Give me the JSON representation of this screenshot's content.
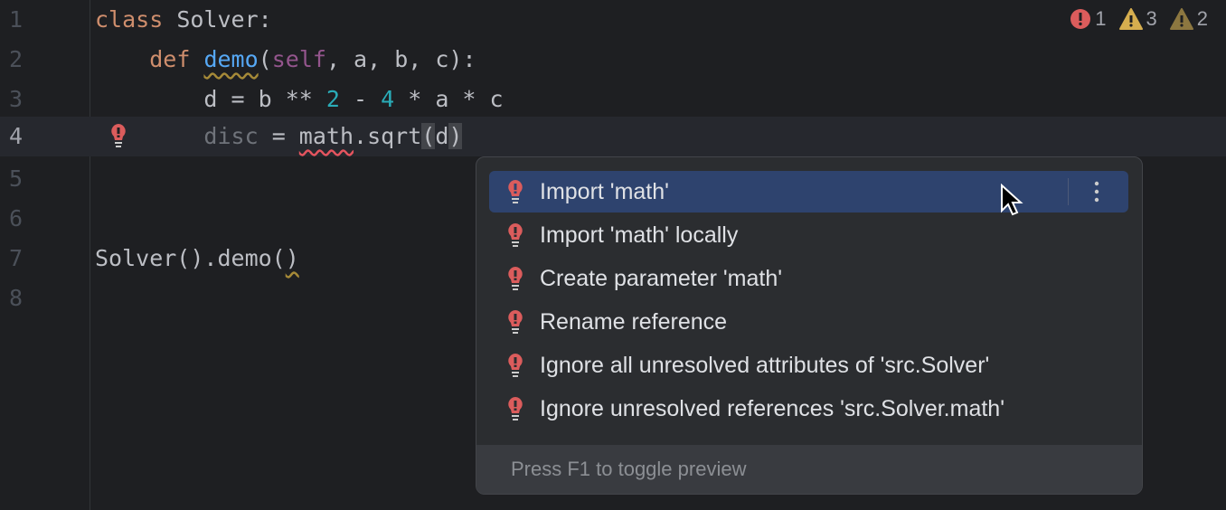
{
  "editor": {
    "line_numbers": [
      "1",
      "2",
      "3",
      "4",
      "5",
      "6",
      "7",
      "8"
    ],
    "lines": {
      "l1": [
        "class",
        " Solver:"
      ],
      "l2": [
        "def ",
        "demo",
        "(",
        "self",
        ", a, b, c):"
      ],
      "l3": [
        "d = b ** ",
        "2",
        " - ",
        "4",
        " * a * c"
      ],
      "l4": [
        "disc",
        " = ",
        "math",
        ".sqrt",
        "(",
        "d",
        ")"
      ],
      "l7": [
        "Solver().demo(",
        ")"
      ]
    }
  },
  "inspections": {
    "errors": "1",
    "warnings": "3",
    "weak_warnings": "2"
  },
  "popup": {
    "items": [
      "Import 'math'",
      "Import 'math' locally",
      "Create parameter 'math'",
      "Rename reference",
      "Ignore all unresolved attributes of 'src.Solver'",
      "Ignore unresolved references 'src.Solver.math'"
    ],
    "footer": "Press F1 to toggle preview"
  },
  "colors": {
    "error": "#db5c5c",
    "warning": "#d6ae4f",
    "selection": "#2e436e"
  }
}
